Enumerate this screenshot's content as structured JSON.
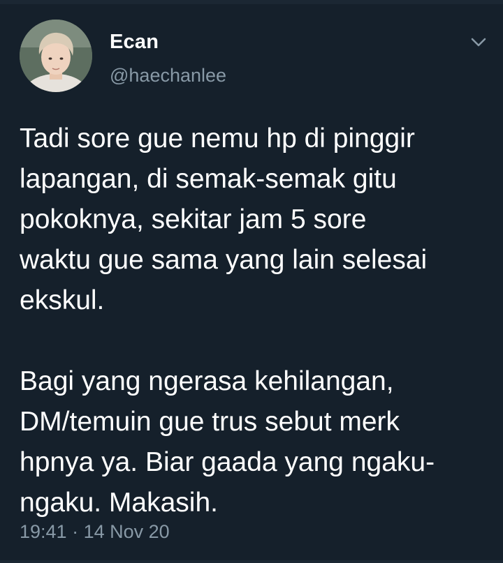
{
  "tweet": {
    "author": {
      "display_name": "Ecan",
      "handle": "@haechanlee"
    },
    "menu_icon": "chevron-down-icon",
    "body": {
      "paragraph_1": "Tadi sore gue nemu hp di pinggir\nlapangan, di semak-semak gitu\npokoknya, sekitar jam 5 sore\nwaktu gue sama yang lain selesai\nekskul.",
      "paragraph_2": "Bagi yang ngerasa kehilangan,\nDM/temuin gue trus sebut merk\nhpnya ya. Biar gaada yang ngaku-\nngaku. Makasih."
    },
    "time": "19:41",
    "separator": "·",
    "date": "14 Nov 20"
  },
  "colors": {
    "background": "#15202b",
    "primary_text": "#ffffff",
    "secondary_text": "#8899a6"
  }
}
